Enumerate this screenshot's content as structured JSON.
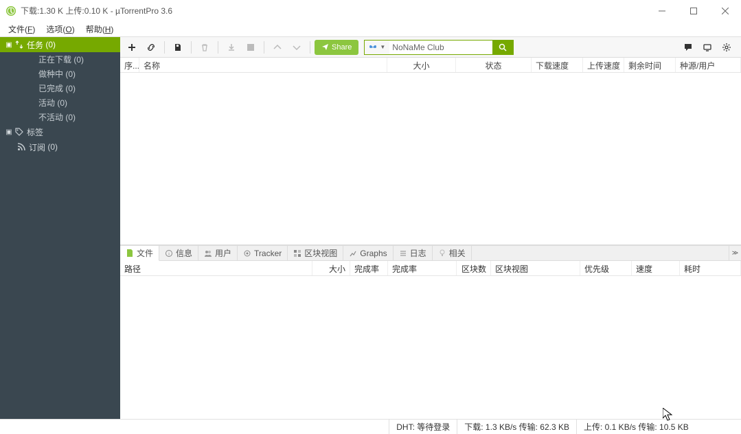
{
  "title": "下载:1.30 K 上传:0.10 K - µTorrentPro 3.6",
  "menu": {
    "file": "文件(F)",
    "options": "选项(O)",
    "help": "帮助(H)"
  },
  "sidebar": {
    "tasks": {
      "label": "任务",
      "count": "(0)"
    },
    "downloading": {
      "label": "正在下载",
      "count": "(0)"
    },
    "seeding": {
      "label": "做种中",
      "count": "(0)"
    },
    "completed": {
      "label": "已完成",
      "count": "(0)"
    },
    "active": {
      "label": "活动",
      "count": "(0)"
    },
    "inactive": {
      "label": "不活动",
      "count": "(0)"
    },
    "labels": {
      "label": "标签"
    },
    "feeds": {
      "label": "订阅",
      "count": "(0)"
    }
  },
  "toolbar": {
    "share": "Share"
  },
  "search": {
    "engine": "NoNaMe Club",
    "placeholder": ""
  },
  "columns": {
    "ord": "序...",
    "name": "名称",
    "size": "大小",
    "status": "状态",
    "dlspeed": "下载速度",
    "ulspeed": "上传速度",
    "eta": "剩余时间",
    "peers": "种源/用户"
  },
  "tabs": {
    "files": "文件",
    "info": "信息",
    "peers": "用户",
    "tracker": "Tracker",
    "pieces": "区块视图",
    "graphs": "Graphs",
    "log": "日志",
    "related": "相关"
  },
  "detailcols": {
    "path": "路径",
    "size": "大小",
    "done1": "完成率",
    "done2": "完成率",
    "pieces": "区块数",
    "piecesview": "区块视图",
    "priority": "优先级",
    "speed": "速度",
    "elapsed": "耗时"
  },
  "status": {
    "dht": "DHT: 等待登录",
    "down": "下载: 1.3 KB/s 传输: 62.3 KB",
    "up": "上传: 0.1 KB/s 传输: 10.5 KB"
  }
}
